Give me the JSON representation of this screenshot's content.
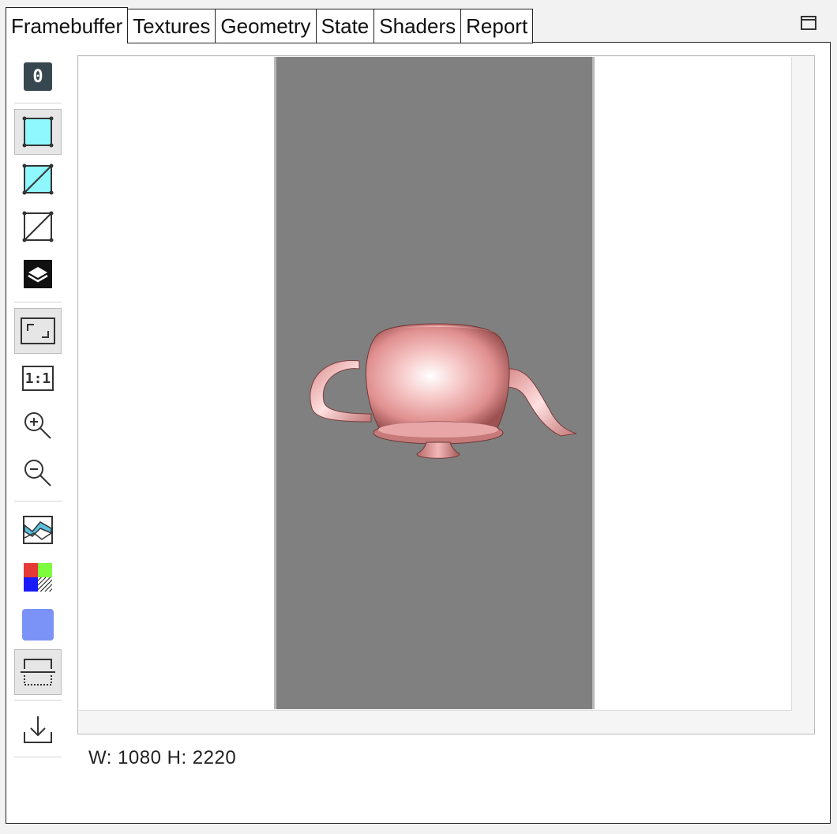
{
  "tabs": [
    {
      "label": "Framebuffer",
      "active": true
    },
    {
      "label": "Textures",
      "active": false
    },
    {
      "label": "Geometry",
      "active": false
    },
    {
      "label": "State",
      "active": false
    },
    {
      "label": "Shaders",
      "active": false
    },
    {
      "label": "Report",
      "active": false
    }
  ],
  "toolbar": {
    "attachment_label": "0",
    "ratio_label": "1:1",
    "icons": [
      "attachment-0-icon",
      "solid-quad-icon",
      "solid-wireframe-icon",
      "wireframe-icon",
      "layers-icon",
      "fit-to-window-icon",
      "actual-size-icon",
      "zoom-in-icon",
      "zoom-out-icon",
      "histogram-image-icon",
      "color-channels-icon",
      "background-color-icon",
      "flip-y-icon",
      "save-icon"
    ],
    "background_color": "#7b93f7"
  },
  "status": {
    "dimensions": "W: 1080 H: 2220"
  },
  "colors": {
    "render_background": "#808080",
    "teapot": "#e89a9a",
    "accent_cyan": "#8ff8ff"
  }
}
